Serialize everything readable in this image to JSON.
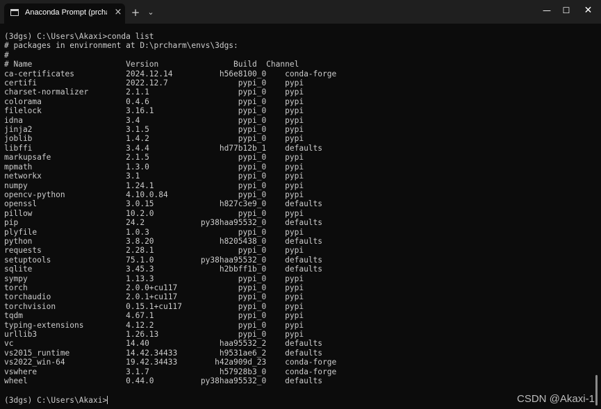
{
  "window": {
    "tab_title": "Anaconda Prompt (prcharm)",
    "tab_close": "×",
    "new_tab": "+",
    "tab_dropdown": "⌄",
    "minimize": "—",
    "maximize": "☐",
    "close": "✕"
  },
  "terminal": {
    "prompt": "(3dgs) C:\\Users\\Akaxi>",
    "command": "conda list",
    "env_line": "# packages in environment at D:\\prcharm\\envs\\3dgs:",
    "comment_line": "#",
    "headers": {
      "name": "# Name",
      "version": "Version",
      "build": "Build",
      "channel": "Channel"
    },
    "packages": [
      {
        "name": "ca-certificates",
        "version": "2024.12.14",
        "build": "h56e8100_0",
        "channel": "conda-forge"
      },
      {
        "name": "certifi",
        "version": "2022.12.7",
        "build": "pypi_0",
        "channel": "pypi"
      },
      {
        "name": "charset-normalizer",
        "version": "2.1.1",
        "build": "pypi_0",
        "channel": "pypi"
      },
      {
        "name": "colorama",
        "version": "0.4.6",
        "build": "pypi_0",
        "channel": "pypi"
      },
      {
        "name": "filelock",
        "version": "3.16.1",
        "build": "pypi_0",
        "channel": "pypi"
      },
      {
        "name": "idna",
        "version": "3.4",
        "build": "pypi_0",
        "channel": "pypi"
      },
      {
        "name": "jinja2",
        "version": "3.1.5",
        "build": "pypi_0",
        "channel": "pypi"
      },
      {
        "name": "joblib",
        "version": "1.4.2",
        "build": "pypi_0",
        "channel": "pypi"
      },
      {
        "name": "libffi",
        "version": "3.4.4",
        "build": "hd77b12b_1",
        "channel": "defaults"
      },
      {
        "name": "markupsafe",
        "version": "2.1.5",
        "build": "pypi_0",
        "channel": "pypi"
      },
      {
        "name": "mpmath",
        "version": "1.3.0",
        "build": "pypi_0",
        "channel": "pypi"
      },
      {
        "name": "networkx",
        "version": "3.1",
        "build": "pypi_0",
        "channel": "pypi"
      },
      {
        "name": "numpy",
        "version": "1.24.1",
        "build": "pypi_0",
        "channel": "pypi"
      },
      {
        "name": "opencv-python",
        "version": "4.10.0.84",
        "build": "pypi_0",
        "channel": "pypi"
      },
      {
        "name": "openssl",
        "version": "3.0.15",
        "build": "h827c3e9_0",
        "channel": "defaults"
      },
      {
        "name": "pillow",
        "version": "10.2.0",
        "build": "pypi_0",
        "channel": "pypi"
      },
      {
        "name": "pip",
        "version": "24.2",
        "build": "py38haa95532_0",
        "channel": "defaults"
      },
      {
        "name": "plyfile",
        "version": "1.0.3",
        "build": "pypi_0",
        "channel": "pypi"
      },
      {
        "name": "python",
        "version": "3.8.20",
        "build": "h8205438_0",
        "channel": "defaults"
      },
      {
        "name": "requests",
        "version": "2.28.1",
        "build": "pypi_0",
        "channel": "pypi"
      },
      {
        "name": "setuptools",
        "version": "75.1.0",
        "build": "py38haa95532_0",
        "channel": "defaults"
      },
      {
        "name": "sqlite",
        "version": "3.45.3",
        "build": "h2bbff1b_0",
        "channel": "defaults"
      },
      {
        "name": "sympy",
        "version": "1.13.3",
        "build": "pypi_0",
        "channel": "pypi"
      },
      {
        "name": "torch",
        "version": "2.0.0+cu117",
        "build": "pypi_0",
        "channel": "pypi"
      },
      {
        "name": "torchaudio",
        "version": "2.0.1+cu117",
        "build": "pypi_0",
        "channel": "pypi"
      },
      {
        "name": "torchvision",
        "version": "0.15.1+cu117",
        "build": "pypi_0",
        "channel": "pypi"
      },
      {
        "name": "tqdm",
        "version": "4.67.1",
        "build": "pypi_0",
        "channel": "pypi"
      },
      {
        "name": "typing-extensions",
        "version": "4.12.2",
        "build": "pypi_0",
        "channel": "pypi"
      },
      {
        "name": "urllib3",
        "version": "1.26.13",
        "build": "pypi_0",
        "channel": "pypi"
      },
      {
        "name": "vc",
        "version": "14.40",
        "build": "haa95532_2",
        "channel": "defaults"
      },
      {
        "name": "vs2015_runtime",
        "version": "14.42.34433",
        "build": "h9531ae6_2",
        "channel": "defaults"
      },
      {
        "name": "vs2022_win-64",
        "version": "19.42.34433",
        "build": "h42a909d_23",
        "channel": "conda-forge"
      },
      {
        "name": "vswhere",
        "version": "3.1.7",
        "build": "h57928b3_0",
        "channel": "conda-forge"
      },
      {
        "name": "wheel",
        "version": "0.44.0",
        "build": "py38haa95532_0",
        "channel": "defaults"
      }
    ],
    "final_prompt": "(3dgs) C:\\Users\\Akaxi>"
  },
  "watermark": "CSDN @Akaxi-1",
  "colors": {
    "terminal_bg": "#0c0c0c",
    "titlebar_bg": "#1f1f1f",
    "text": "#cccccc"
  }
}
